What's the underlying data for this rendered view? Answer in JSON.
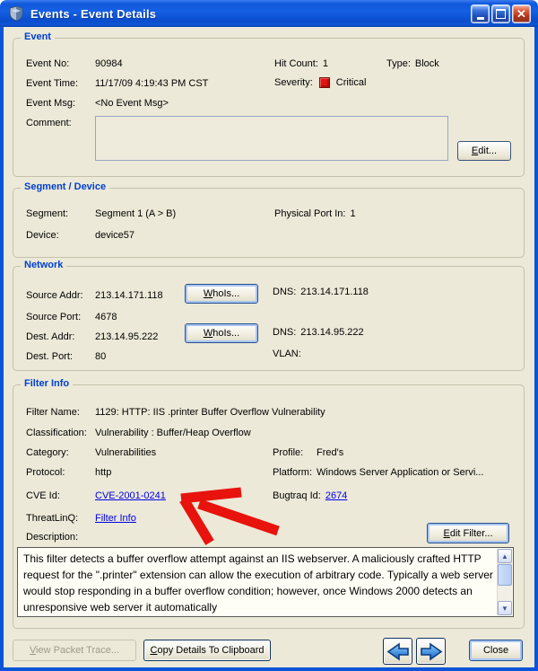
{
  "window": {
    "title": "Events - Event Details"
  },
  "icons": {
    "close": "✕",
    "scroll_up": "▲",
    "scroll_down": "▼"
  },
  "colors": {
    "titlebar_blue": "#1058dc",
    "dialog_bg": "#ece9d8",
    "group_title_blue": "#0040d0",
    "link_blue": "#0000e8",
    "severity_red": "#e01414",
    "annotation_arrow_red": "#e8130d",
    "nav_arrow_blue": "#2f8ee6"
  },
  "event": {
    "title": "Event",
    "event_no_label": "Event No:",
    "event_no": "90984",
    "hit_count_label": "Hit Count:",
    "hit_count": "1",
    "type_label": "Type:",
    "type_value": "Block",
    "event_time_label": "Event Time:",
    "event_time": "11/17/09 4:19:43 PM CST",
    "severity_label": "Severity:",
    "severity_value": "Critical",
    "event_msg_label": "Event Msg:",
    "event_msg": "<No Event Msg>",
    "comment_label": "Comment:",
    "comment_value": "",
    "edit_button": "Edit..."
  },
  "segment_device": {
    "title": "Segment / Device",
    "segment_label": "Segment:",
    "segment_value": "Segment 1 (A > B)",
    "physical_port_in_label": "Physical Port In:",
    "physical_port_in": "1",
    "device_label": "Device:",
    "device_value": "device57"
  },
  "network": {
    "title": "Network",
    "source_addr_label": "Source Addr:",
    "source_addr": "213.14.171.118",
    "source_whois_button": "WhoIs...",
    "source_dns_label": "DNS:",
    "source_dns": "213.14.171.118",
    "source_port_label": "Source Port:",
    "source_port": "4678",
    "dest_addr_label": "Dest. Addr:",
    "dest_addr": "213.14.95.222",
    "dest_whois_button": "WhoIs...",
    "dest_dns_label": "DNS:",
    "dest_dns": "213.14.95.222",
    "dest_port_label": "Dest. Port:",
    "dest_port": "80",
    "vlan_label": "VLAN:",
    "vlan_value": ""
  },
  "filter_info": {
    "title": "Filter Info",
    "filter_name_label": "Filter Name:",
    "filter_name": "1129: HTTP: IIS .printer Buffer Overflow Vulnerability",
    "classification_label": "Classification:",
    "classification": "Vulnerability : Buffer/Heap Overflow",
    "category_label": "Category:",
    "category": "Vulnerabilities",
    "profile_label": "Profile:",
    "profile": "Fred's",
    "protocol_label": "Protocol:",
    "protocol": "http",
    "platform_label": "Platform:",
    "platform": "Windows Server Application or Servi...",
    "cve_id_label": "CVE Id:",
    "cve_id_link": "CVE-2001-0241",
    "bugtraq_id_label": "Bugtraq Id:",
    "bugtraq_id_link": "2674",
    "threatlinq_label": "ThreatLinQ:",
    "threatlinq_link": "Filter Info",
    "description_label": "Description:",
    "edit_filter_button": "Edit Filter...",
    "description_text": "This filter detects a buffer overflow attempt against an IIS webserver. A maliciously crafted HTTP request for the \".printer\" extension can allow the execution of arbitrary code. Typically a web server would stop responding in a buffer overflow condition; however, once Windows 2000 detects an unresponsive web server it automatically"
  },
  "footer": {
    "view_packet_trace_button": "View Packet Trace...",
    "copy_details_button": "Copy Details To Clipboard",
    "close_button": "Close"
  }
}
